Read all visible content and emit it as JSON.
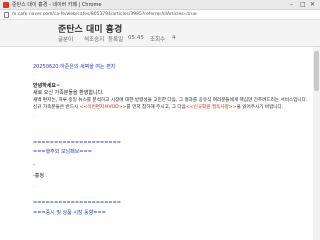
{
  "browser": {
    "tab_title": "준탄스 대이 흉경 - 네이버 카페 | Chrome",
    "url": "m.cafe.naver.com/ca-fe/web/cafes/8053794/articles/3985?referrerAllArticles=true",
    "controls": [
      "–",
      "□",
      "✕"
    ]
  },
  "article": {
    "title": "준탄스 대미 흉경",
    "board": "글분이",
    "author": "석조승지",
    "reg_label": "등록일",
    "time": "05:45",
    "views_label": "조회수",
    "views": "4"
  },
  "content": {
    "date_line": "20250620 하준은의 새벽을 여는 편지",
    "dot": "·",
    "greeting": "안녕하세요~",
    "intro": "새로 오신 가족분들을 환영합니다.",
    "desc": "새벽 편지는, 하루 중일 뉴스를 분석하고 시장에 대한 방향성을 고민한 다음, 그 절과를 공유식 여러분들에게 핵심만 간추려드리는 서비스입니다.",
    "notice_pre": "신규 가족분들은 반드시 ",
    "notice_link1": "<<이번편지브VOD>>",
    "notice_mid": "를 먼저 참하해 주시고, 그 다음",
    "notice_link2": "<<신규회원 필독사항>>",
    "notice_post": "을 읽어주시기 바랍니다.",
    "sep1": "=====================",
    "section1": "===행주외 모닝패브===",
    "dash1": "-",
    "label1": "-흉정",
    "sep2": "=====================",
    "section2": "===중시 및 상품 시장 동향==="
  }
}
